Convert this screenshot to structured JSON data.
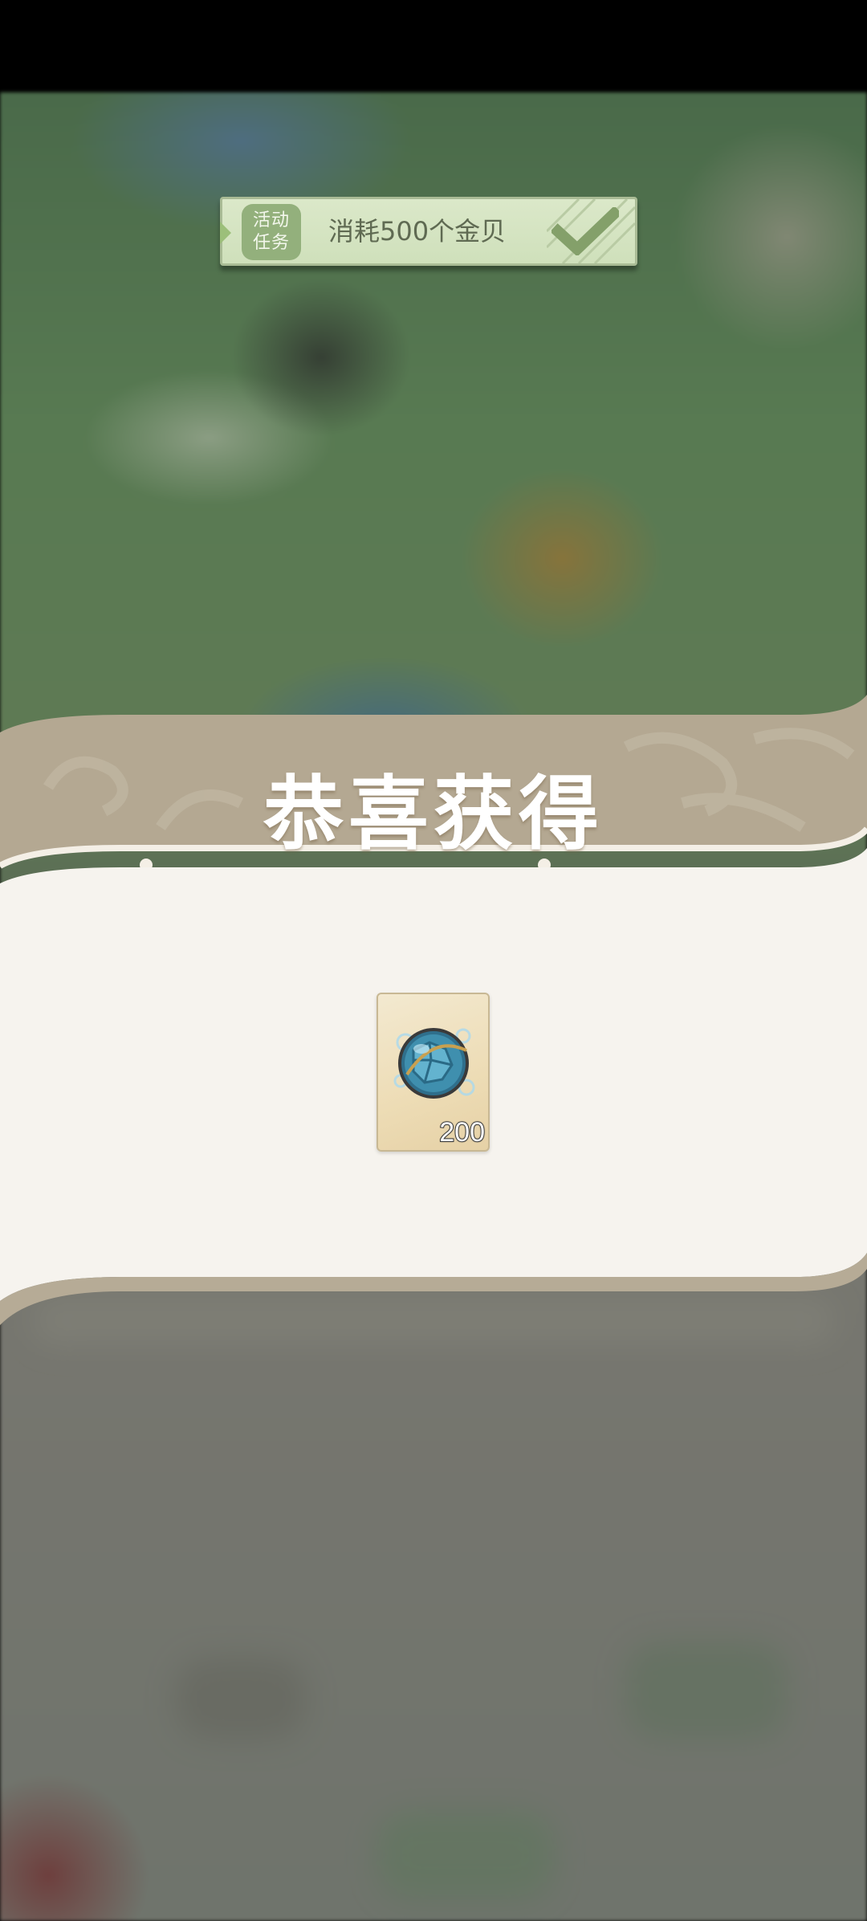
{
  "task_banner": {
    "tag_line1": "活动",
    "tag_line2": "任务",
    "text": "消耗500个金贝",
    "icon": "check-icon"
  },
  "reward": {
    "title": "恭喜获得",
    "items": [
      {
        "icon": "blue-orb-icon",
        "count": "200"
      }
    ]
  },
  "colors": {
    "banner_bg": "#d3e2bf",
    "tag_bg": "#93b07c",
    "panel_header": "#b6ab96",
    "panel_body": "#f6f3ee",
    "title_text": "#ffffff"
  }
}
